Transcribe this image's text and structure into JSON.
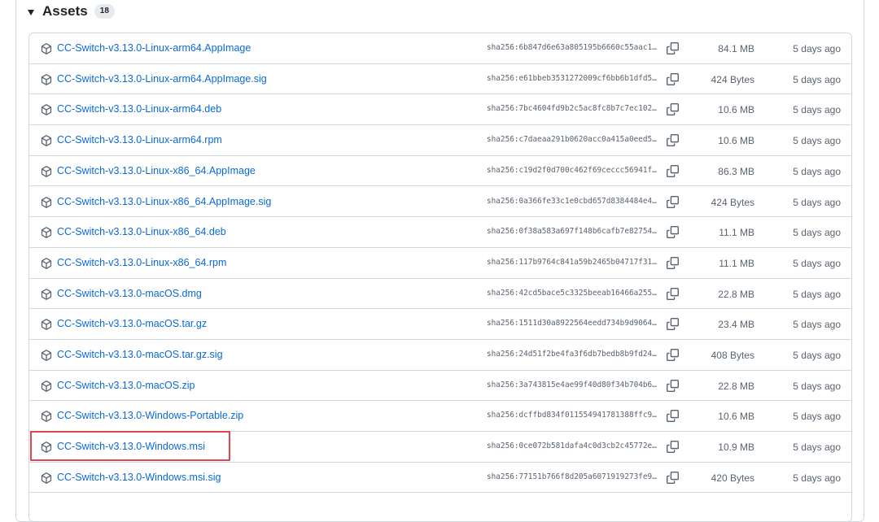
{
  "assets": {
    "title": "Assets",
    "count": "18",
    "rows": [
      {
        "name": "CC-Switch-v3.13.0-Linux-arm64.AppImage",
        "sha": "sha256:6b847d6e63a805195b6660c55aac1…",
        "size": "84.1 MB",
        "date": "5 days ago"
      },
      {
        "name": "CC-Switch-v3.13.0-Linux-arm64.AppImage.sig",
        "sha": "sha256:e61bbeb3531272009cf6bb6b1dfd5…",
        "size": "424 Bytes",
        "date": "5 days ago"
      },
      {
        "name": "CC-Switch-v3.13.0-Linux-arm64.deb",
        "sha": "sha256:7bc4604fd9b2c5ac8fc8b7c7ec102…",
        "size": "10.6 MB",
        "date": "5 days ago"
      },
      {
        "name": "CC-Switch-v3.13.0-Linux-arm64.rpm",
        "sha": "sha256:c7daeaa291b0620acc0a415a0eed5…",
        "size": "10.6 MB",
        "date": "5 days ago"
      },
      {
        "name": "CC-Switch-v3.13.0-Linux-x86_64.AppImage",
        "sha": "sha256:c19d2f0d700c462f69ceccc56941f…",
        "size": "86.3 MB",
        "date": "5 days ago"
      },
      {
        "name": "CC-Switch-v3.13.0-Linux-x86_64.AppImage.sig",
        "sha": "sha256:0a366fe33c1e0cbd657d8384484e4…",
        "size": "424 Bytes",
        "date": "5 days ago"
      },
      {
        "name": "CC-Switch-v3.13.0-Linux-x86_64.deb",
        "sha": "sha256:0f38a583a697f148b6cafb7e82754…",
        "size": "11.1 MB",
        "date": "5 days ago"
      },
      {
        "name": "CC-Switch-v3.13.0-Linux-x86_64.rpm",
        "sha": "sha256:117b9764c841a59b2465b04717f31…",
        "size": "11.1 MB",
        "date": "5 days ago"
      },
      {
        "name": "CC-Switch-v3.13.0-macOS.dmg",
        "sha": "sha256:42cd5bace5c3325beeab16466a255…",
        "size": "22.8 MB",
        "date": "5 days ago"
      },
      {
        "name": "CC-Switch-v3.13.0-macOS.tar.gz",
        "sha": "sha256:1511d30a8922564eedd734b9d9064…",
        "size": "23.4 MB",
        "date": "5 days ago"
      },
      {
        "name": "CC-Switch-v3.13.0-macOS.tar.gz.sig",
        "sha": "sha256:24d51f2be4fa3f6db7bedb8b9fd24…",
        "size": "408 Bytes",
        "date": "5 days ago"
      },
      {
        "name": "CC-Switch-v3.13.0-macOS.zip",
        "sha": "sha256:3a743815e4ae99f40d80f34b704b6…",
        "size": "22.8 MB",
        "date": "5 days ago"
      },
      {
        "name": "CC-Switch-v3.13.0-Windows-Portable.zip",
        "sha": "sha256:dcffbd834f011554941781388ffc9…",
        "size": "10.6 MB",
        "date": "5 days ago"
      },
      {
        "name": "CC-Switch-v3.13.0-Windows.msi",
        "sha": "sha256:0ce072b581dafa4c0d3cb2c45772e…",
        "size": "10.9 MB",
        "date": "5 days ago"
      },
      {
        "name": "CC-Switch-v3.13.0-Windows.msi.sig",
        "sha": "sha256:77151b766f8d205a6071919273fe9…",
        "size": "420 Bytes",
        "date": "5 days ago"
      },
      {
        "name": "",
        "sha": "",
        "size": "",
        "date": ""
      }
    ],
    "highlighted_row": 13,
    "highlight_color": "#e0474c"
  },
  "colors": {
    "link": "#0969da",
    "muted": "#59636e",
    "border": "#d1d9e0"
  }
}
